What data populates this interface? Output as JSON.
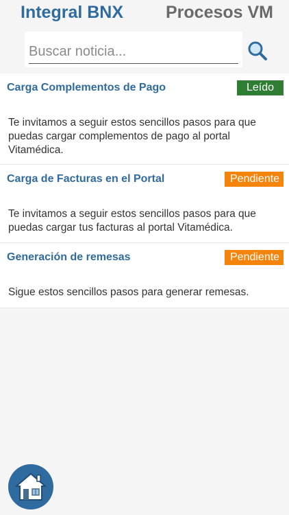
{
  "tabs": {
    "integral": "Integral BNX",
    "procesos": "Procesos VM"
  },
  "search": {
    "placeholder": "Buscar noticia...",
    "value": ""
  },
  "news": [
    {
      "title": "Carga Complementos de Pago",
      "status": "Leído",
      "description": "Te invitamos a seguir estos sencillos pasos para que puedas cargar complementos de pago al portal Vitamédica."
    },
    {
      "title": "Carga de Facturas en el Portal",
      "status": "Pendiente",
      "description": "Te invitamos a seguir estos sencillos pasos para que puedas cargar tus facturas al portal Vitamédica."
    },
    {
      "title": "Generación de remesas",
      "status": "Pendiente",
      "description": "Sigue estos sencillos pasos para generar remesas."
    }
  ],
  "colors": {
    "accent": "#2f6b9e",
    "status_read": "#2e7d32",
    "status_pending": "#f5840c"
  },
  "icons": {
    "search": "magnifier-icon",
    "home": "home-icon"
  }
}
